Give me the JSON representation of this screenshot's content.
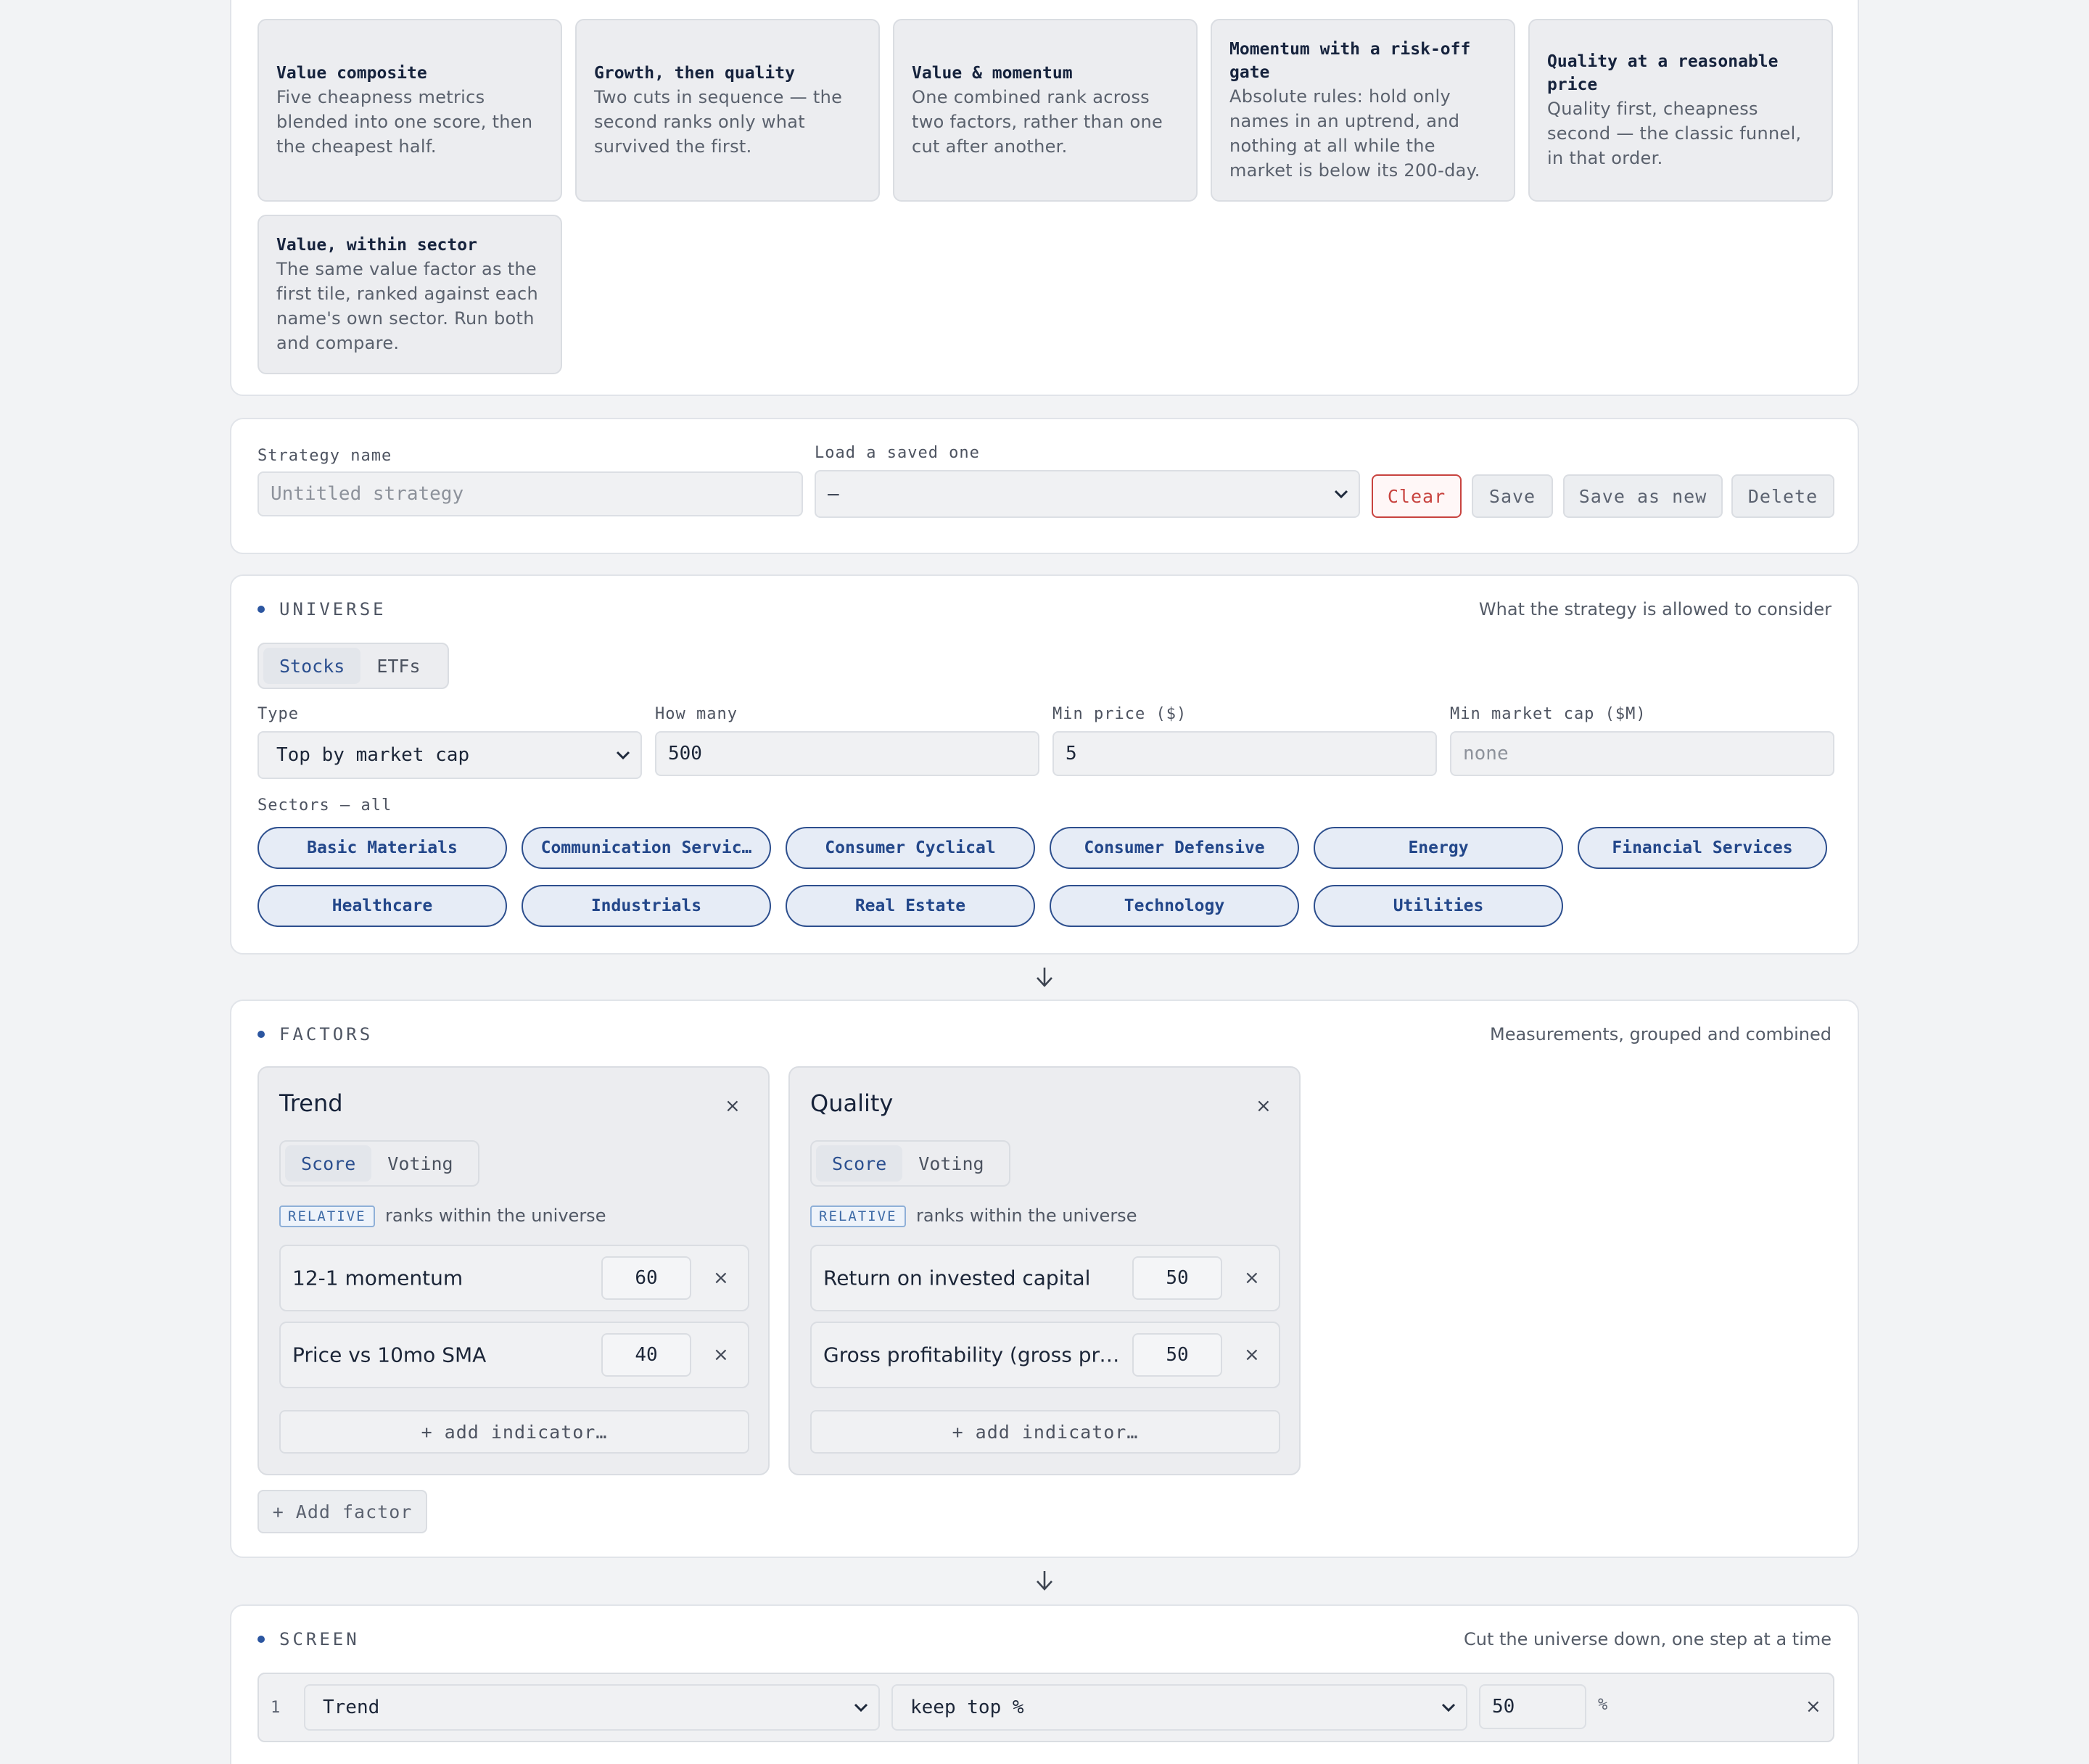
{
  "presets": [
    {
      "title": "Value composite",
      "desc": "Five cheapness metrics blended into one score, then the cheapest half."
    },
    {
      "title": "Growth, then quality",
      "desc": "Two cuts in sequence — the second ranks only what survived the first."
    },
    {
      "title": "Value & momentum",
      "desc": "One combined rank across two factors, rather than one cut after another."
    },
    {
      "title": "Momentum with a risk-off gate",
      "desc": "Absolute rules: hold only names in an uptrend, and nothing at all while the market is below its 200-day."
    },
    {
      "title": "Quality at a reasonable price",
      "desc": "Quality first, cheapness second — the classic funnel, in that order."
    },
    {
      "title": "Value, within sector",
      "desc": "The same value factor as the first tile, ranked against each name's own sector. Run both and compare."
    }
  ],
  "strategy": {
    "name_label": "Strategy name",
    "name_placeholder": "Untitled strategy",
    "load_label": "Load a saved one",
    "load_value": "—",
    "clear_label": "Clear",
    "save_label": "Save",
    "save_new_label": "Save as new",
    "delete_label": "Delete"
  },
  "universe": {
    "title": "UNIVERSE",
    "subtitle": "What the strategy is allowed to consider",
    "toggle": [
      "Stocks",
      "ETFs"
    ],
    "type_label": "Type",
    "type_value": "Top by market cap",
    "how_many_label": "How many",
    "how_many_value": "500",
    "min_price_label": "Min price ($)",
    "min_price_value": "5",
    "min_cap_label": "Min market cap ($M)",
    "min_cap_placeholder": "none",
    "sectors_label": "Sectors — all",
    "sectors": [
      "Basic Materials",
      "Communication Servic…",
      "Consumer Cyclical",
      "Consumer Defensive",
      "Energy",
      "Financial Services",
      "Healthcare",
      "Industrials",
      "Real Estate",
      "Technology",
      "Utilities"
    ]
  },
  "factors": {
    "title": "FACTORS",
    "subtitle": "Measurements, grouped and combined",
    "items": [
      {
        "name": "Trend",
        "modes": [
          "Score",
          "Voting"
        ],
        "badge": "RELATIVE",
        "badge_note": "ranks within the universe",
        "indicators": [
          {
            "name": "12-1 momentum",
            "weight": "60"
          },
          {
            "name": "Price vs 10mo SMA",
            "weight": "40"
          }
        ],
        "add_label": "+ add indicator…"
      },
      {
        "name": "Quality",
        "modes": [
          "Score",
          "Voting"
        ],
        "badge": "RELATIVE",
        "badge_note": "ranks within the universe",
        "indicators": [
          {
            "name": "Return on invested capital",
            "weight": "50"
          },
          {
            "name": "Gross profitability (gross profit …",
            "weight": "50"
          }
        ],
        "add_label": "+ add indicator…"
      }
    ],
    "add_factor_label": "+ Add factor"
  },
  "screen": {
    "title": "SCREEN",
    "subtitle": "Cut the universe down, one step at a time",
    "rows": [
      {
        "index": "1",
        "factor": "Trend",
        "rule": "keep top %",
        "value": "50",
        "unit": "%"
      }
    ]
  },
  "icons": {
    "close": "×",
    "arrow_down": "arrow-down-icon",
    "chevron": "chevron-down-icon"
  },
  "colors": {
    "accent": "#2c56a0",
    "danger": "#c8433f",
    "background": "#f2f3f5"
  }
}
